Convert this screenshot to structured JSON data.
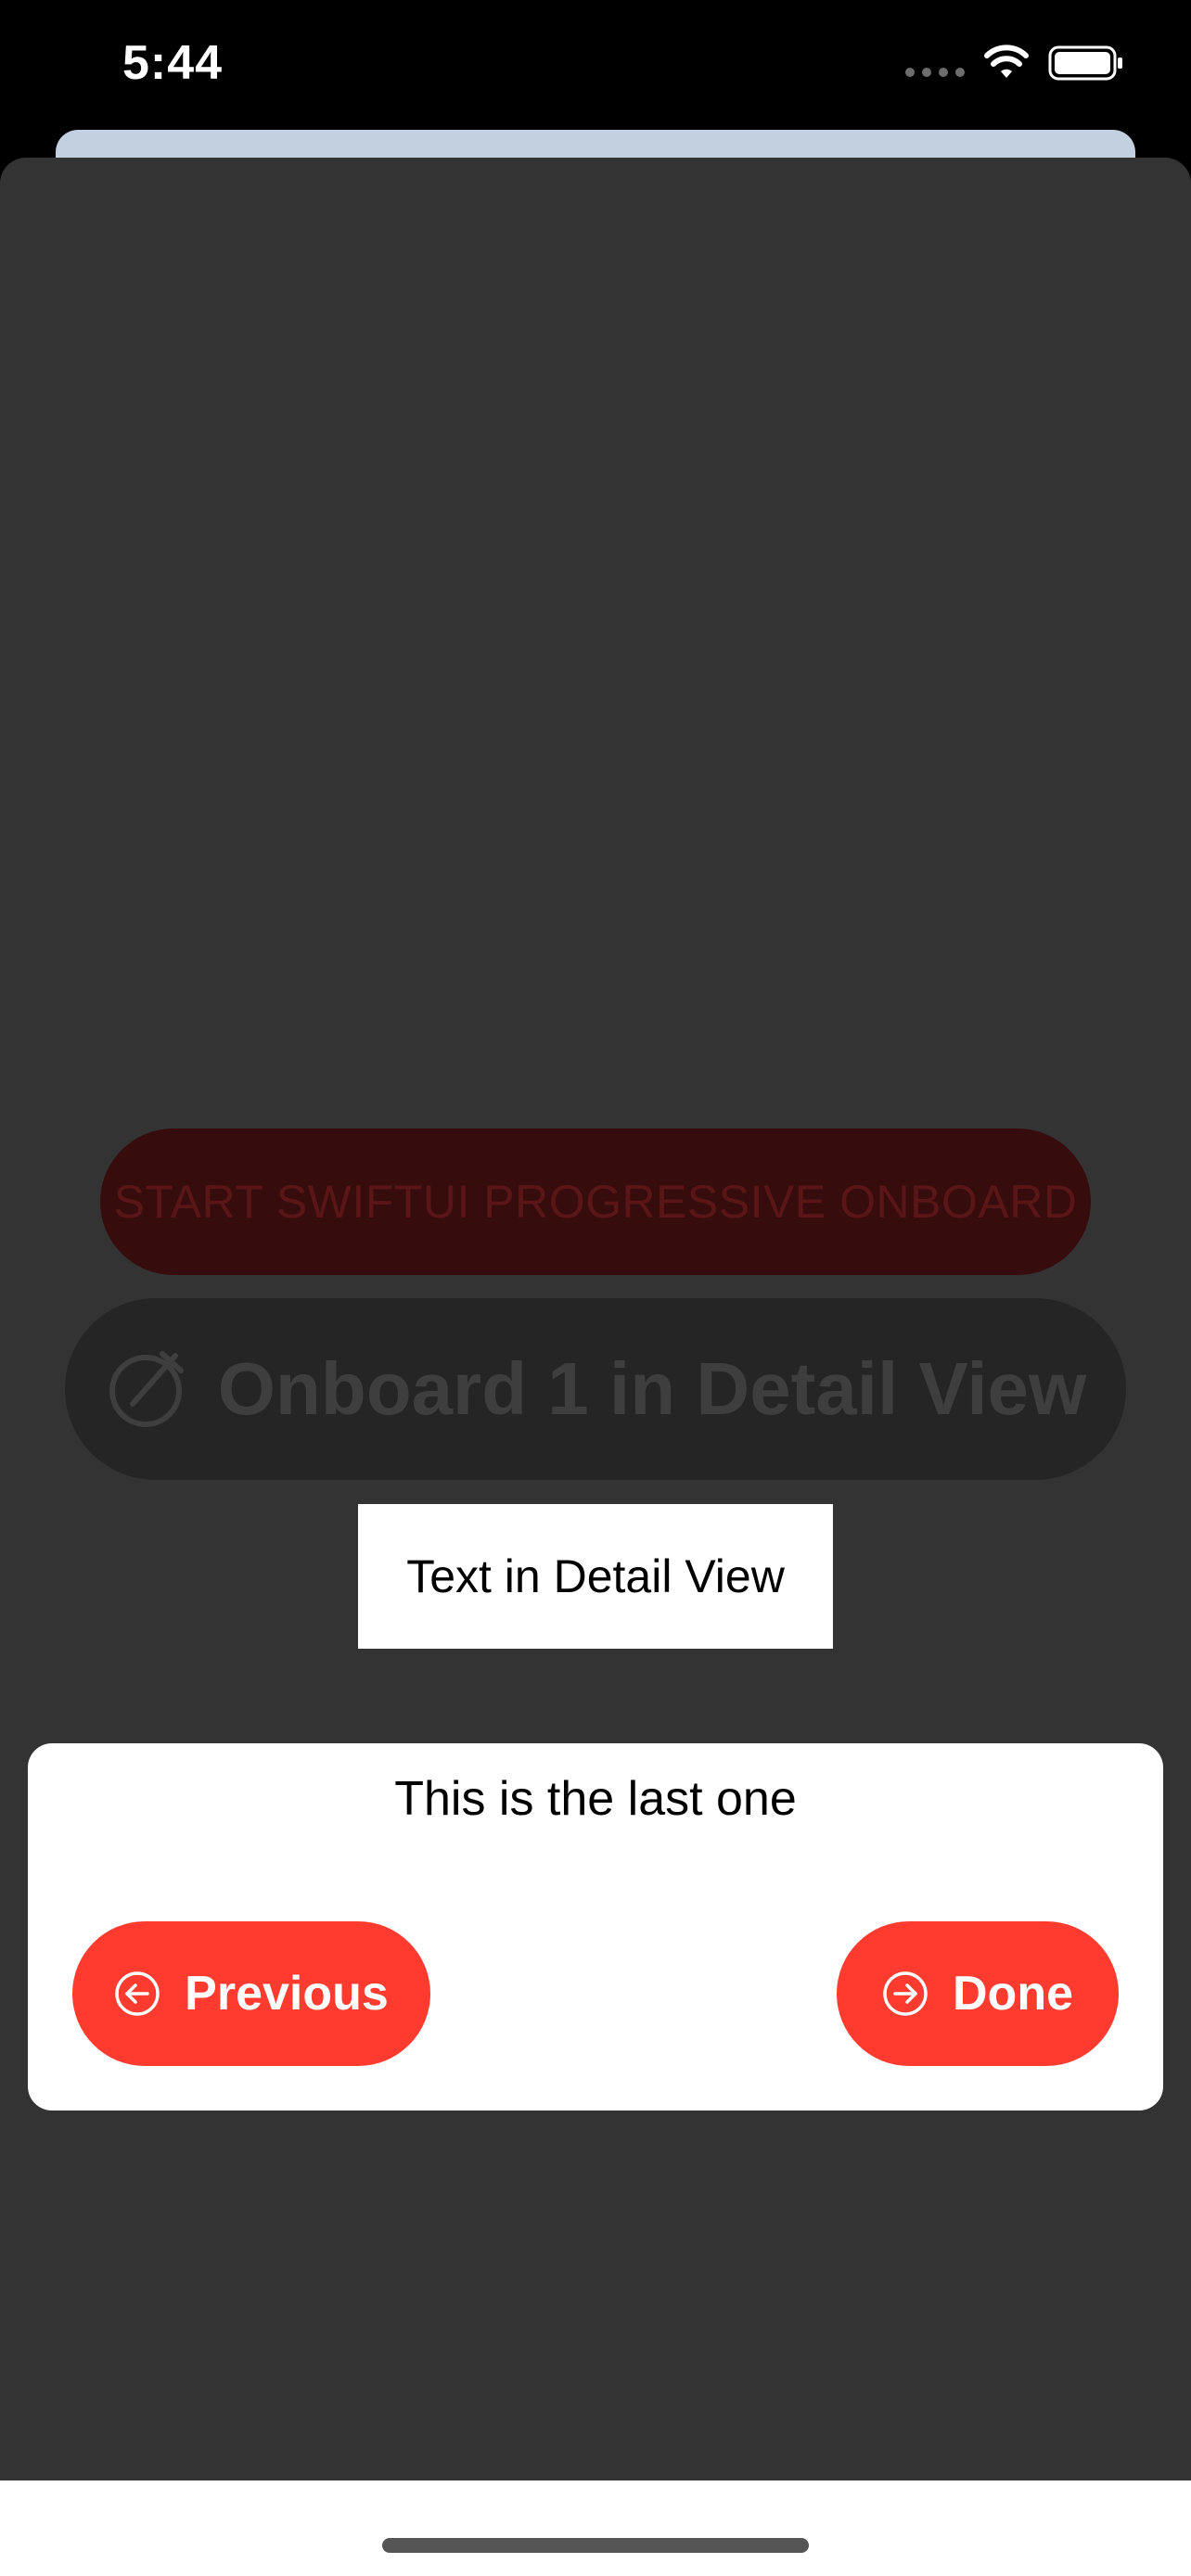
{
  "status_bar": {
    "time": "5:44",
    "icons": [
      "signal-dots-icon",
      "wifi-icon",
      "battery-icon"
    ]
  },
  "main": {
    "start_button_label": "START SWIFTUI PROGRESSIVE ONBOARD",
    "onboard_button_label": "Onboard 1 in Detail View",
    "onboard_button_icon": "pencil-slash-circle-icon",
    "detail_text": "Text in Detail View"
  },
  "tooltip": {
    "message": "This is the last one",
    "previous_label": "Previous",
    "done_label": "Done",
    "previous_icon": "arrow-left-circle-icon",
    "done_icon": "arrow-right-circle-icon"
  },
  "colors": {
    "accent": "#ff3b30",
    "overlay": "#333333",
    "status_bar": "#000000",
    "sheet_peek": "#c3d0e0"
  }
}
